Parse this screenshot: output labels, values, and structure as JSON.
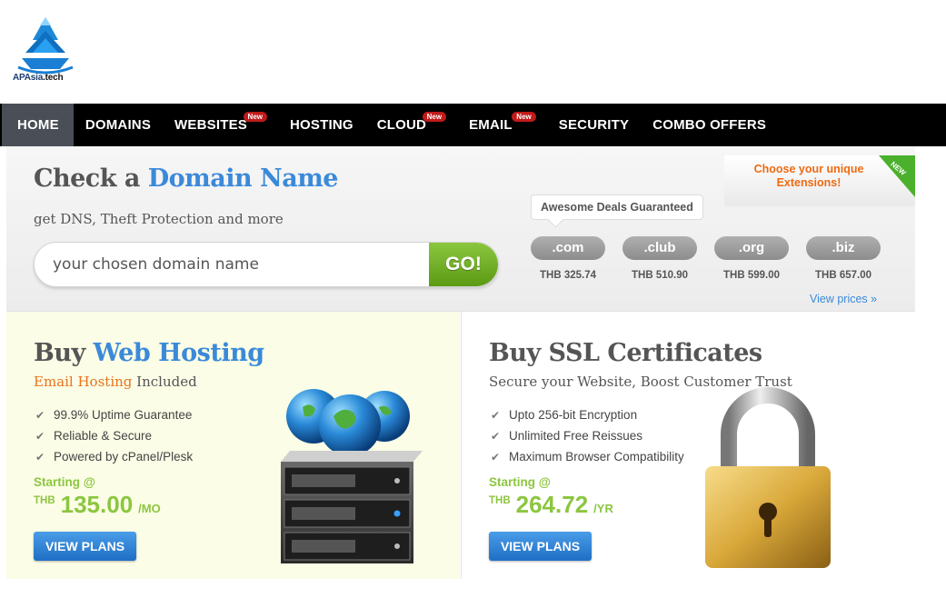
{
  "brand": {
    "name": "APAsia",
    "tld": ".tech"
  },
  "nav": [
    {
      "label": "HOME",
      "active": true,
      "badge": ""
    },
    {
      "label": "DOMAINS",
      "badge": ""
    },
    {
      "label": "WEBSITES",
      "badge": "New"
    },
    {
      "label": "HOSTING",
      "badge": ""
    },
    {
      "label": "CLOUD",
      "badge": "New"
    },
    {
      "label": "EMAIL",
      "badge": "New"
    },
    {
      "label": "SECURITY",
      "badge": ""
    },
    {
      "label": "COMBO OFFERS",
      "badge": ""
    }
  ],
  "domain_search": {
    "title_prefix": "Check a",
    "title_accent": "Domain Name",
    "subtitle": "get DNS, Theft Protection and more",
    "placeholder": "your chosen domain name",
    "go_label": "GO!",
    "deals_label": "Awesome Deals Guaranteed",
    "promo_text": "Choose your unique Extensions!",
    "promo_badge": "NEW",
    "extensions": [
      {
        "ext": ".com",
        "price": "THB 325.74"
      },
      {
        "ext": ".club",
        "price": "THB 510.90"
      },
      {
        "ext": ".org",
        "price": "THB 599.00"
      },
      {
        "ext": ".biz",
        "price": "THB 657.00"
      }
    ],
    "view_prices": "View prices »"
  },
  "hosting": {
    "title_prefix": "Buy",
    "title_accent": "Web Hosting",
    "subtitle_accent": "Email Hosting",
    "subtitle_rest": "Included",
    "features": [
      "99.9% Uptime Guarantee",
      "Reliable & Secure",
      "Powered by cPanel/Plesk"
    ],
    "starting_label": "Starting @",
    "currency": "THB",
    "amount": "135.00",
    "period": "/MO",
    "button": "VIEW PLANS"
  },
  "ssl": {
    "title": "Buy SSL Certificates",
    "subtitle": "Secure your Website, Boost Customer Trust",
    "features": [
      "Upto 256-bit Encryption",
      "Unlimited Free Reissues",
      "Maximum Browser Compatibility"
    ],
    "starting_label": "Starting @",
    "currency": "THB",
    "amount": "264.72",
    "period": "/YR",
    "button": "VIEW PLANS"
  },
  "colors": {
    "accent_blue": "#3b8ad9",
    "green": "#8cc63f",
    "orange": "#e8731c",
    "nav_bg": "#000000",
    "badge_red": "#c01a1a"
  }
}
